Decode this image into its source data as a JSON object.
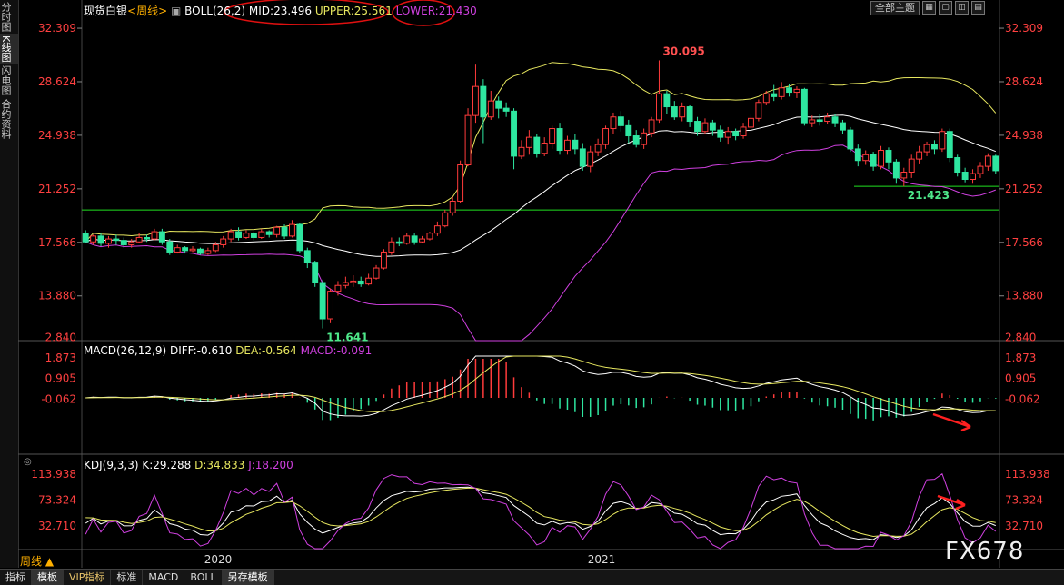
{
  "sidebar": {
    "tabs": [
      {
        "label": "分时图"
      },
      {
        "label": "K线图"
      },
      {
        "label": "闪电图"
      },
      {
        "label": "合约资料"
      }
    ]
  },
  "toolbar": {
    "theme_label": "全部主题",
    "icons": [
      "grid-icon",
      "box-icon",
      "window-icon",
      "restore-icon"
    ]
  },
  "main_panel": {
    "symbol": "现货白银",
    "period": "<周线>",
    "boll_label": "BOLL(26,2)",
    "mid": "MID:23.496",
    "upper": "UPPER:25.561",
    "lower": "LOWER:21.430",
    "high_label": "30.095",
    "low_label": "11.641",
    "recent_low_label": "21.423"
  },
  "macd_panel": {
    "label": "MACD(26,12,9)",
    "diff": "DIFF:-0.610",
    "dea": "DEA:-0.564",
    "macd": "MACD:-0.091"
  },
  "kdj_panel": {
    "label": "KDJ(9,3,3)",
    "k": "K:29.288",
    "d": "D:34.833",
    "j": "J:18.200"
  },
  "period_selector": "周线 ▲",
  "bottom_tabs": [
    "指标",
    "模板",
    "VIP指标",
    "标准",
    "MACD",
    "BOLL",
    "另存模板"
  ],
  "watermark": "FX678",
  "colors": {
    "up": "#ff3b3b",
    "down": "#2ee6a0",
    "mid": "#ffffff",
    "upper": "#e8e860",
    "lower": "#d040e0",
    "support": "#20e020"
  },
  "chart_data": [
    {
      "type": "candlestick",
      "title": "现货白银 周线",
      "y_ticks": [
        "32.309",
        "28.624",
        "24.938",
        "21.252",
        "17.566",
        "13.880"
      ],
      "x_ticks": [
        "2020",
        "2021"
      ],
      "ylim": [
        10.5,
        33.5
      ],
      "annotations": [
        {
          "label": "30.095",
          "x": "2021 high",
          "y": 30.095
        },
        {
          "label": "11.641",
          "x": "2020 low",
          "y": 11.641
        },
        {
          "label": "21.423",
          "x": "recent low",
          "y": 21.423
        }
      ],
      "support_line": 19.8,
      "candles": [
        [
          18.2,
          17.6,
          18.4,
          17.5
        ],
        [
          17.6,
          18.0,
          18.1,
          17.4
        ],
        [
          18.0,
          17.5,
          18.2,
          17.3
        ],
        [
          17.5,
          17.8,
          18.0,
          17.2
        ],
        [
          17.8,
          17.7,
          18.1,
          17.4
        ],
        [
          17.7,
          17.4,
          17.9,
          17.2
        ],
        [
          17.4,
          17.6,
          17.8,
          17.2
        ],
        [
          17.6,
          17.9,
          18.2,
          17.5
        ],
        [
          17.9,
          17.8,
          18.1,
          17.6
        ],
        [
          17.8,
          18.3,
          18.5,
          17.7
        ],
        [
          18.3,
          17.6,
          18.5,
          17.4
        ],
        [
          17.6,
          16.9,
          17.8,
          16.7
        ],
        [
          16.9,
          17.2,
          17.4,
          16.8
        ],
        [
          17.2,
          17.0,
          17.3,
          16.8
        ],
        [
          17.0,
          17.1,
          17.3,
          16.9
        ],
        [
          17.1,
          16.8,
          17.2,
          16.7
        ],
        [
          16.8,
          17.0,
          17.2,
          16.7
        ],
        [
          17.0,
          17.4,
          17.6,
          16.9
        ],
        [
          17.4,
          17.8,
          18.0,
          17.2
        ],
        [
          17.8,
          18.3,
          18.5,
          17.6
        ],
        [
          18.3,
          17.9,
          18.6,
          17.7
        ],
        [
          17.9,
          18.2,
          18.4,
          17.8
        ],
        [
          18.2,
          17.9,
          18.3,
          17.7
        ],
        [
          17.9,
          18.3,
          18.5,
          17.8
        ],
        [
          18.3,
          18.1,
          18.4,
          17.9
        ],
        [
          18.1,
          18.6,
          18.7,
          17.9
        ],
        [
          18.6,
          18.0,
          18.8,
          17.8
        ],
        [
          18.0,
          18.8,
          19.1,
          17.9
        ],
        [
          18.8,
          17.0,
          18.9,
          16.8
        ],
        [
          17.0,
          16.2,
          17.2,
          15.8
        ],
        [
          16.2,
          14.8,
          16.3,
          14.5
        ],
        [
          14.8,
          12.3,
          15.0,
          11.641
        ],
        [
          12.3,
          14.2,
          14.4,
          12.0
        ],
        [
          14.2,
          14.6,
          14.9,
          13.9
        ],
        [
          14.6,
          14.8,
          15.2,
          14.4
        ],
        [
          14.8,
          14.9,
          15.3,
          14.5
        ],
        [
          14.9,
          14.7,
          15.2,
          14.5
        ],
        [
          14.7,
          15.1,
          15.4,
          14.6
        ],
        [
          15.1,
          15.8,
          16.0,
          15.0
        ],
        [
          15.8,
          16.9,
          17.1,
          15.7
        ],
        [
          16.9,
          17.6,
          17.9,
          16.7
        ],
        [
          17.6,
          17.5,
          17.9,
          17.3
        ],
        [
          17.5,
          18.0,
          18.2,
          17.4
        ],
        [
          18.0,
          17.6,
          18.2,
          17.4
        ],
        [
          17.6,
          17.8,
          18.0,
          17.5
        ],
        [
          17.8,
          18.2,
          18.3,
          17.7
        ],
        [
          18.2,
          18.7,
          19.0,
          18.0
        ],
        [
          18.7,
          19.6,
          19.8,
          18.6
        ],
        [
          19.6,
          20.4,
          20.7,
          19.4
        ],
        [
          20.4,
          22.9,
          23.2,
          20.3
        ],
        [
          22.9,
          26.3,
          26.8,
          22.8
        ],
        [
          26.3,
          28.3,
          29.8,
          25.8
        ],
        [
          28.3,
          26.2,
          28.8,
          24.4
        ],
        [
          26.2,
          27.3,
          28.0,
          26.0
        ],
        [
          27.3,
          26.8,
          27.6,
          26.1
        ],
        [
          26.8,
          26.6,
          27.2,
          26.2
        ],
        [
          26.6,
          23.5,
          26.8,
          22.6
        ],
        [
          23.5,
          24.1,
          24.6,
          23.3
        ],
        [
          24.1,
          24.8,
          25.3,
          23.6
        ],
        [
          24.8,
          23.7,
          25.0,
          23.4
        ],
        [
          23.7,
          24.4,
          24.8,
          23.5
        ],
        [
          24.4,
          25.4,
          25.6,
          24.0
        ],
        [
          25.4,
          23.9,
          25.8,
          23.6
        ],
        [
          23.9,
          24.6,
          24.9,
          23.6
        ],
        [
          24.6,
          24.0,
          25.0,
          23.6
        ],
        [
          24.0,
          22.8,
          24.4,
          22.5
        ],
        [
          22.8,
          23.8,
          24.2,
          22.4
        ],
        [
          23.8,
          24.3,
          24.7,
          23.5
        ],
        [
          24.3,
          25.4,
          25.6,
          24.0
        ],
        [
          25.4,
          26.2,
          26.5,
          25.0
        ],
        [
          26.2,
          25.6,
          26.6,
          25.2
        ],
        [
          25.6,
          24.9,
          26.0,
          24.4
        ],
        [
          24.9,
          24.3,
          25.3,
          24.1
        ],
        [
          24.3,
          25.1,
          25.4,
          24.0
        ],
        [
          25.1,
          26.0,
          26.2,
          24.8
        ],
        [
          26.0,
          27.8,
          30.095,
          25.8
        ],
        [
          27.8,
          26.9,
          28.0,
          26.4
        ],
        [
          26.9,
          26.2,
          27.3,
          26.0
        ],
        [
          26.2,
          26.9,
          27.2,
          25.9
        ],
        [
          26.9,
          25.9,
          27.0,
          25.5
        ],
        [
          25.9,
          25.2,
          26.2,
          24.9
        ],
        [
          25.2,
          25.8,
          26.1,
          25.0
        ],
        [
          25.8,
          25.3,
          26.0,
          24.9
        ],
        [
          25.3,
          24.8,
          25.6,
          24.5
        ],
        [
          24.8,
          25.2,
          25.5,
          24.3
        ],
        [
          25.2,
          24.9,
          25.4,
          24.6
        ],
        [
          24.9,
          25.5,
          25.8,
          24.7
        ],
        [
          25.5,
          26.1,
          26.4,
          25.3
        ],
        [
          26.1,
          27.2,
          27.4,
          25.9
        ],
        [
          27.2,
          27.8,
          28.0,
          27.0
        ],
        [
          27.8,
          27.6,
          28.4,
          27.3
        ],
        [
          27.6,
          28.2,
          28.6,
          27.4
        ],
        [
          28.2,
          27.9,
          28.5,
          27.6
        ],
        [
          27.9,
          28.1,
          28.3,
          27.5
        ],
        [
          28.1,
          25.8,
          28.2,
          25.6
        ],
        [
          25.8,
          26.0,
          26.3,
          25.5
        ],
        [
          26.0,
          25.9,
          26.4,
          25.6
        ],
        [
          25.9,
          26.2,
          26.5,
          25.7
        ],
        [
          26.2,
          25.8,
          26.4,
          25.5
        ],
        [
          25.8,
          25.3,
          26.0,
          25.0
        ],
        [
          25.3,
          24.0,
          25.5,
          23.8
        ],
        [
          24.0,
          23.2,
          24.3,
          22.8
        ],
        [
          23.2,
          23.6,
          23.9,
          22.9
        ],
        [
          23.6,
          22.8,
          23.8,
          22.5
        ],
        [
          22.8,
          23.9,
          24.2,
          22.6
        ],
        [
          23.9,
          23.1,
          24.1,
          22.6
        ],
        [
          23.1,
          22.0,
          23.3,
          21.6
        ],
        [
          22.0,
          22.4,
          22.7,
          21.423
        ],
        [
          22.4,
          23.3,
          23.6,
          22.0
        ],
        [
          23.3,
          23.8,
          24.2,
          23.0
        ],
        [
          23.8,
          24.3,
          24.5,
          23.5
        ],
        [
          24.3,
          24.0,
          24.6,
          23.6
        ],
        [
          24.0,
          25.2,
          25.4,
          23.8
        ],
        [
          25.2,
          23.4,
          25.4,
          23.1
        ],
        [
          23.4,
          22.4,
          23.6,
          22.1
        ],
        [
          22.4,
          21.9,
          22.7,
          21.7
        ],
        [
          21.9,
          22.3,
          22.6,
          21.6
        ],
        [
          22.3,
          22.8,
          23.1,
          22.0
        ],
        [
          22.8,
          23.5,
          23.7,
          22.5
        ],
        [
          23.5,
          22.5,
          23.6,
          22.3
        ]
      ]
    }
  ]
}
